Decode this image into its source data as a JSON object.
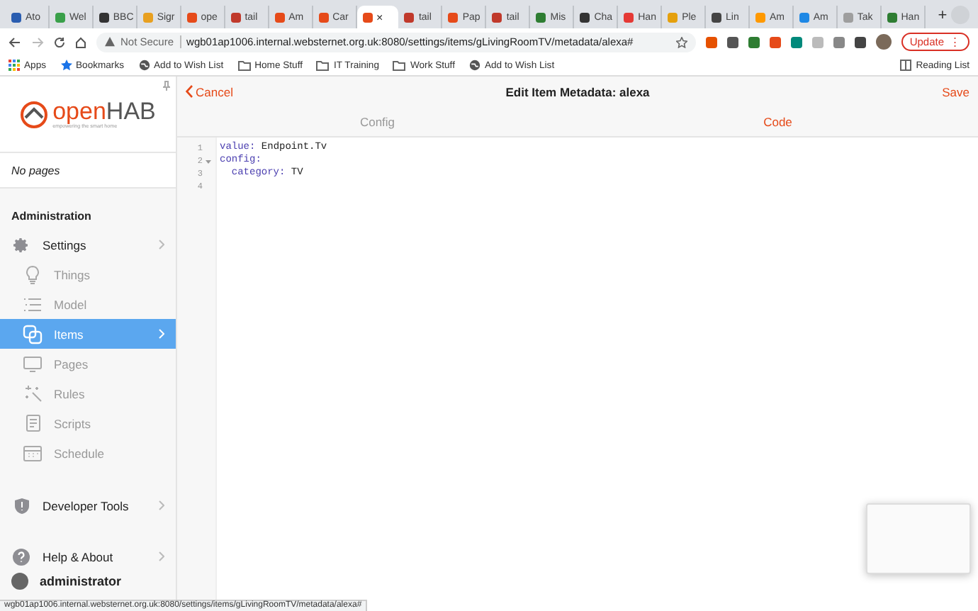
{
  "browser": {
    "tabs": [
      {
        "label": "Ato",
        "color": "#2a5db0",
        "selected": false
      },
      {
        "label": "Wel",
        "color": "#3aa04a",
        "selected": false
      },
      {
        "label": "BBC",
        "color": "#333333",
        "selected": false
      },
      {
        "label": "Sigr",
        "color": "#e8a020",
        "selected": false
      },
      {
        "label": "ope",
        "color": "#e64a19",
        "selected": false
      },
      {
        "label": "tail",
        "color": "#c0392b",
        "selected": false
      },
      {
        "label": "Am",
        "color": "#e64a19",
        "selected": false
      },
      {
        "label": "Car",
        "color": "#e64a19",
        "selected": false
      },
      {
        "close": "×",
        "color": "#e64a19",
        "selected": true
      },
      {
        "label": "tail",
        "color": "#c0392b",
        "selected": false
      },
      {
        "label": "Pap",
        "color": "#e64a19",
        "selected": false
      },
      {
        "label": "tail",
        "color": "#c0392b",
        "selected": false
      },
      {
        "label": "Mis",
        "color": "#2e7d32",
        "selected": false
      },
      {
        "label": "Cha",
        "color": "#333333",
        "selected": false
      },
      {
        "label": "Han",
        "color": "#e53935",
        "selected": false
      },
      {
        "label": "Ple",
        "color": "#e5a00d",
        "selected": false
      },
      {
        "label": "Lin",
        "color": "#444444",
        "selected": false
      },
      {
        "label": "Am",
        "color": "#ff9900",
        "selected": false
      },
      {
        "label": "Am",
        "color": "#1e88e5",
        "selected": false
      },
      {
        "label": "Tak",
        "color": "#9e9e9e",
        "selected": false
      },
      {
        "label": "Han",
        "color": "#2e7d32",
        "selected": false
      }
    ],
    "new_tab": "+",
    "security": "Not Secure",
    "url": "wgb01ap1006.internal.websternet.org.uk:8080/settings/items/gLivingRoomTV/metadata/alexa#",
    "update_button": {
      "label": "Update",
      "menu": "⋮"
    },
    "bookmarks": [
      {
        "kind": "apps",
        "label": "Apps"
      },
      {
        "kind": "star",
        "label": "Bookmarks"
      },
      {
        "kind": "link",
        "label": "Add to Wish List"
      },
      {
        "kind": "folder",
        "label": "Home Stuff"
      },
      {
        "kind": "folder",
        "label": "IT Training"
      },
      {
        "kind": "folder",
        "label": "Work Stuff"
      },
      {
        "kind": "link",
        "label": "Add to Wish List"
      }
    ],
    "reading_list": "Reading List",
    "status_url": "wgb01ap1006.internal.websternet.org.uk:8080/settings/items/gLivingRoomTV/metadata/alexa#"
  },
  "sidebar": {
    "logo": {
      "name_light": "open",
      "name_bold": "HAB",
      "tagline": "empowering the smart home"
    },
    "pages_note": "No pages",
    "section": "Administration",
    "menu": [
      {
        "label": "Settings",
        "chevron": true,
        "selected": false,
        "children": [
          {
            "label": "Things",
            "chevron": false,
            "selected": false
          },
          {
            "label": "Model",
            "chevron": false,
            "selected": false
          },
          {
            "label": "Items",
            "chevron": true,
            "selected": true
          },
          {
            "label": "Pages",
            "chevron": false,
            "selected": false
          },
          {
            "label": "Rules",
            "chevron": false,
            "selected": false
          },
          {
            "label": "Scripts",
            "chevron": false,
            "selected": false
          },
          {
            "label": "Schedule",
            "chevron": false,
            "selected": false
          }
        ]
      },
      {
        "label": "Developer Tools",
        "chevron": true,
        "selected": false
      },
      {
        "label": "Help & About",
        "chevron": true,
        "selected": false
      }
    ],
    "user": "administrator"
  },
  "navbar": {
    "back": "Cancel",
    "title": "Edit Item Metadata: alexa",
    "save": "Save"
  },
  "segments": [
    {
      "label": "Config",
      "selected": false
    },
    {
      "label": "Code",
      "selected": true
    }
  ],
  "editor": {
    "line_numbers": [
      "1",
      "2",
      "3",
      "4"
    ],
    "lines": [
      {
        "key": "value:",
        "value": "Endpoint.Tv"
      },
      {
        "key": "config:",
        "expanded": true,
        "children": [
          {
            "key": "category:",
            "value": "TV"
          }
        ]
      }
    ]
  }
}
